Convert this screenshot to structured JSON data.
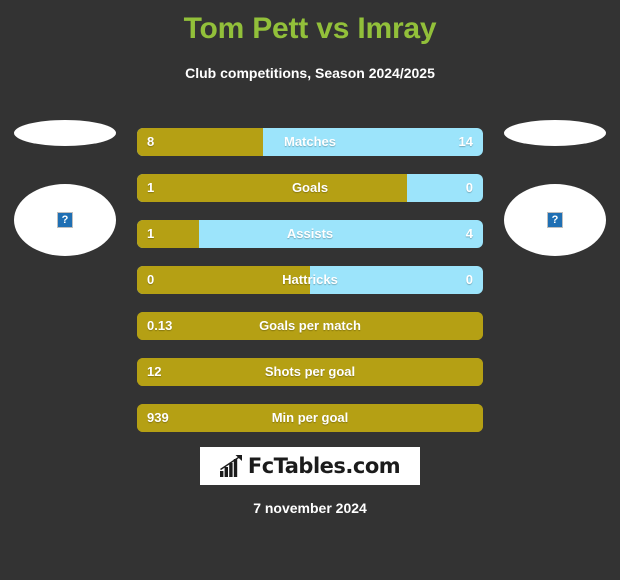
{
  "header": {
    "title": "Tom Pett vs Imray",
    "subtitle": "Club competitions, Season 2024/2025",
    "title_color": "#92c03a"
  },
  "players": {
    "left": {
      "photo_placeholder_icon": "broken-image-icon",
      "photo_alt": "?"
    },
    "right": {
      "photo_placeholder_icon": "broken-image-icon",
      "photo_alt": "?"
    }
  },
  "colors": {
    "background": "#333333",
    "left_player_bar": "#b5a014",
    "right_player_bar": "#9ce4fb",
    "accent_title": "#92c03a",
    "text": "#ffffff"
  },
  "chart_data": {
    "type": "bar",
    "title": "Tom Pett vs Imray",
    "subtitle": "Club competitions, Season 2024/2025",
    "orientation": "horizontal-diverging",
    "series": [
      {
        "name": "Tom Pett",
        "color": "#b5a014"
      },
      {
        "name": "Imray",
        "color": "#9ce4fb"
      }
    ],
    "categories": [
      "Matches",
      "Goals",
      "Assists",
      "Hattricks",
      "Goals per match",
      "Shots per goal",
      "Min per goal"
    ],
    "rows": [
      {
        "label": "Matches",
        "left": "8",
        "right": "14",
        "left_pct": 36.4,
        "single": false
      },
      {
        "label": "Goals",
        "left": "1",
        "right": "0",
        "left_pct": 78.0,
        "single": false
      },
      {
        "label": "Assists",
        "left": "1",
        "right": "4",
        "left_pct": 18.0,
        "single": false
      },
      {
        "label": "Hattricks",
        "left": "0",
        "right": "0",
        "left_pct": 50.0,
        "single": false
      },
      {
        "label": "Goals per match",
        "left": "0.13",
        "right": "",
        "left_pct": 100,
        "single": true
      },
      {
        "label": "Shots per goal",
        "left": "12",
        "right": "",
        "left_pct": 100,
        "single": true
      },
      {
        "label": "Min per goal",
        "left": "939",
        "right": "",
        "left_pct": 100,
        "single": true
      }
    ]
  },
  "logo": {
    "text": "FcTables.com",
    "icon": "bar-chart-up-icon"
  },
  "footer": {
    "date": "7 november 2024"
  }
}
